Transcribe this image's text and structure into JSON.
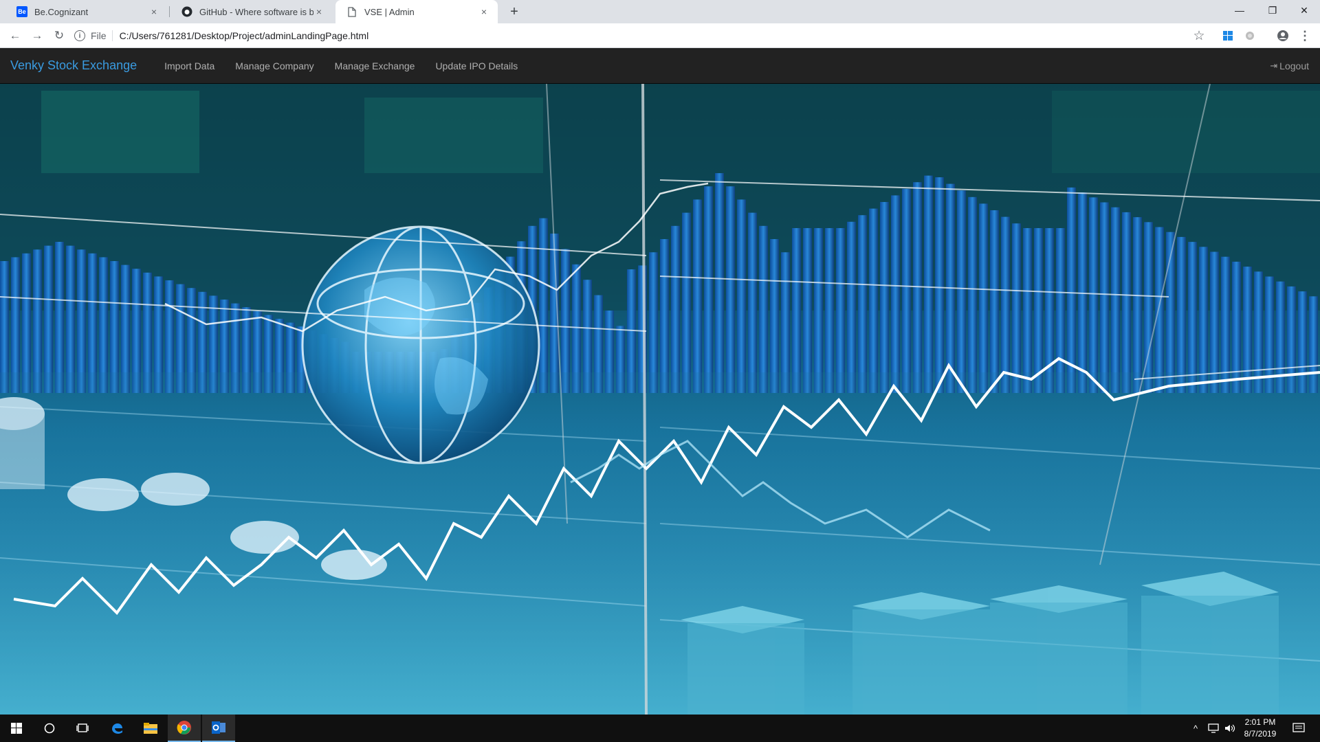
{
  "browser": {
    "tabs": [
      {
        "favicon": "behance-icon",
        "favicon_text": "Be",
        "title": "Be.Cognizant",
        "close": "×"
      },
      {
        "favicon": "github-icon",
        "favicon_text": "",
        "title": "GitHub - Where software is built",
        "close": "×"
      },
      {
        "favicon": "page-icon",
        "favicon_text": "",
        "title": "VSE | Admin",
        "close": "×"
      }
    ],
    "new_tab": "+",
    "window_controls": {
      "minimize": "—",
      "restore": "❐",
      "close": "✕"
    },
    "nav": {
      "back": "←",
      "forward": "→",
      "reload": "↻"
    },
    "address": {
      "info": "i",
      "scheme": "File",
      "url": "C:/Users/761281/Desktop/Project/adminLandingPage.html"
    },
    "toolbar_icons": {
      "star": "☆",
      "profile": "●",
      "menu": "⋮"
    }
  },
  "navbar": {
    "brand": "Venky Stock Exchange",
    "links": [
      "Import Data",
      "Manage Company",
      "Manage Exchange",
      "Update IPO Details"
    ],
    "logout_icon": "⇥",
    "logout": "Logout"
  },
  "hero": {
    "description": "stock market background image",
    "colors": {
      "bars": "#1e6fc4",
      "line": "#ffffff",
      "glow": "#7fd4ff"
    }
  },
  "taskbar": {
    "clock_time": "2:01 PM",
    "clock_date": "8/7/2019",
    "tray": {
      "chevron": "^",
      "network": "▭",
      "volume": "🔈",
      "notifications": "▤"
    }
  }
}
